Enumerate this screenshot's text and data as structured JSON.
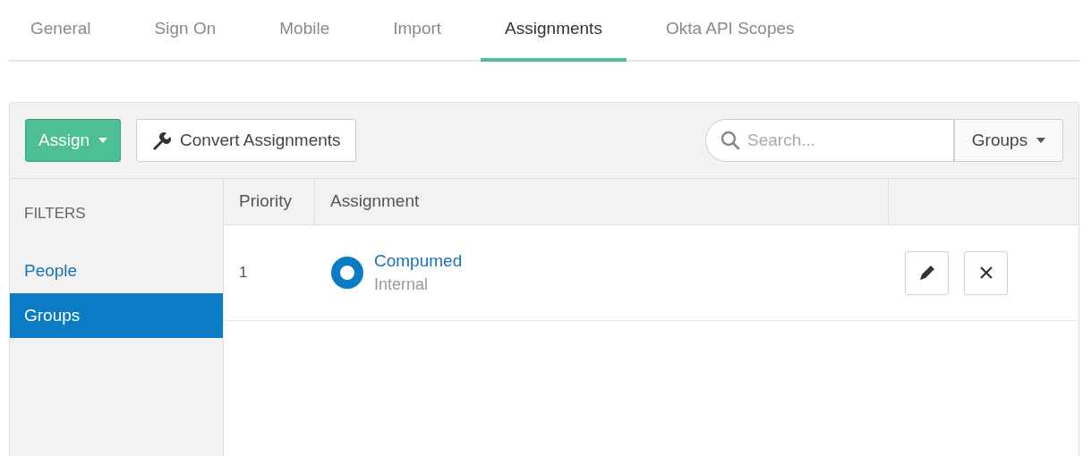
{
  "tabs": [
    {
      "label": "General",
      "selected": false
    },
    {
      "label": "Sign On",
      "selected": false
    },
    {
      "label": "Mobile",
      "selected": false
    },
    {
      "label": "Import",
      "selected": false
    },
    {
      "label": "Assignments",
      "selected": true
    },
    {
      "label": "Okta API Scopes",
      "selected": false
    }
  ],
  "toolbar": {
    "assign_button": "Assign",
    "convert_button": "Convert Assignments",
    "search": {
      "placeholder": "Search..."
    },
    "type_dropdown": "Groups"
  },
  "filters": {
    "title": "FILTERS",
    "items": [
      {
        "label": "People",
        "selected": false
      },
      {
        "label": "Groups",
        "selected": true
      }
    ]
  },
  "table": {
    "columns": [
      "Priority",
      "Assignment"
    ],
    "rows": [
      {
        "priority": "1",
        "name": "Compumed",
        "type": "Internal"
      }
    ]
  }
}
